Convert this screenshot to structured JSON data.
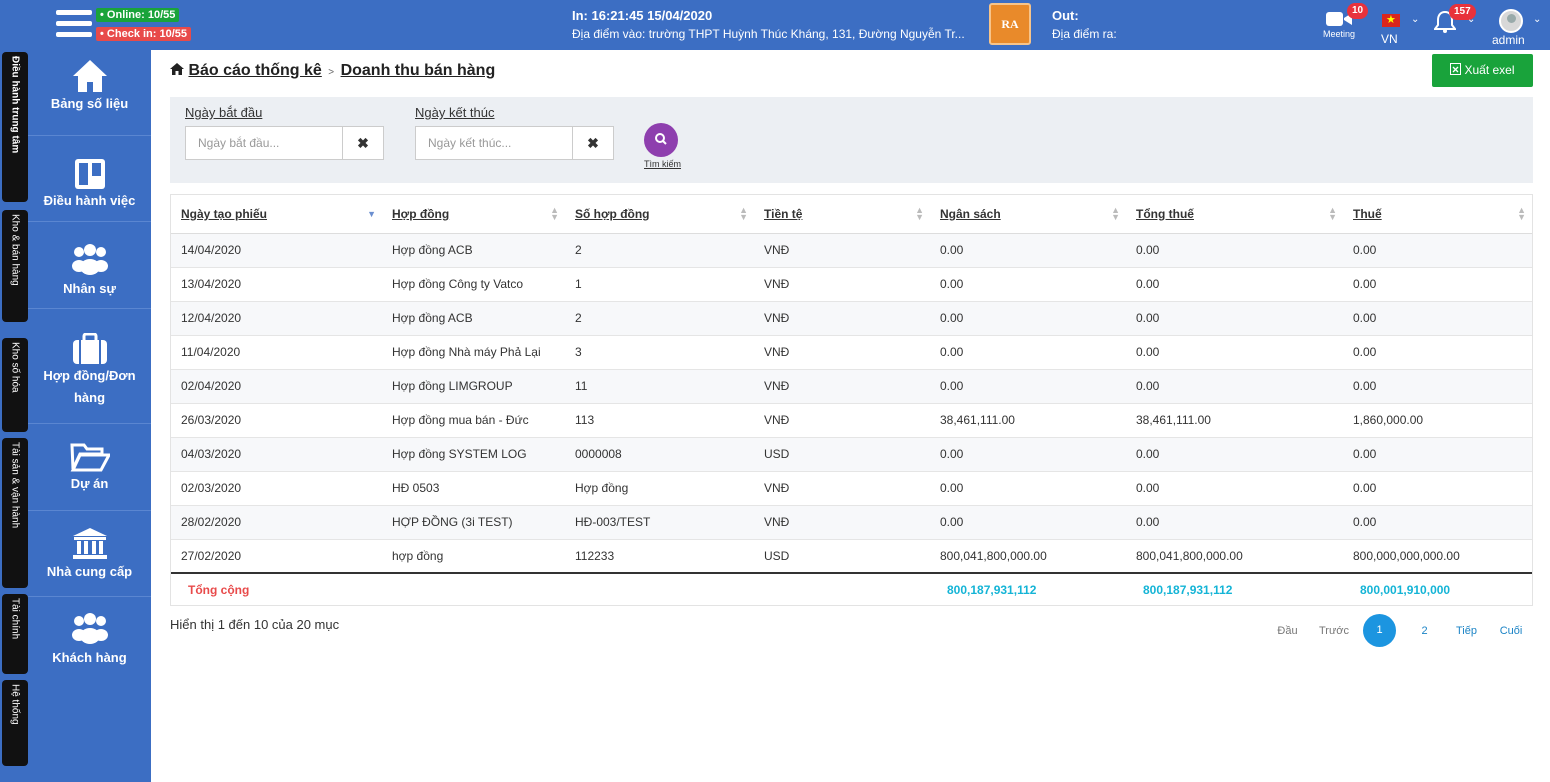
{
  "topbar": {
    "online": "Online: 10/55",
    "checkin": "Check in: 10/55",
    "in_time": "In: 16:21:45 15/04/2020",
    "in_location": "Địa điểm vào: trường THPT Huỳnh Thúc Kháng, 131, Đường Nguyễn Tr...",
    "logo_text": "RA",
    "out_time": "Out:",
    "out_location": "Địa điểm ra:",
    "meeting_label": "Meeting",
    "meeting_count": "10",
    "language": "VN",
    "notification_count": "157",
    "user": "admin"
  },
  "strip_tabs": [
    "Điều hành trung tâm",
    "Kho & bán hàng",
    "Kho số hóa",
    "Tài sản & vận hành",
    "Tài chính",
    "Hệ thống"
  ],
  "sidenav": [
    {
      "label": "Bảng số liệu",
      "icon": "home-icon"
    },
    {
      "label": "Điều hành việc",
      "icon": "board-icon"
    },
    {
      "label": "Nhân sự",
      "icon": "users-icon"
    },
    {
      "label": "Hợp đồng/Đơn hàng",
      "icon": "briefcase-icon"
    },
    {
      "label": "Dự án",
      "icon": "folder-open-icon"
    },
    {
      "label": "Nhà cung cấp",
      "icon": "bank-icon"
    },
    {
      "label": "Khách hàng",
      "icon": "users-icon"
    }
  ],
  "breadcrumb": {
    "parent": "Báo cáo thống kê",
    "separator": ">",
    "current": "Doanh thu bán hàng"
  },
  "export_label": "Xuất exel",
  "filter": {
    "start_label": "Ngày bắt đầu",
    "start_placeholder": "Ngày bắt đầu...",
    "end_label": "Ngày kết thúc",
    "end_placeholder": "Ngày kết thúc...",
    "search_label": "Tìm kiếm"
  },
  "table": {
    "columns": [
      "Ngày tạo phiếu",
      "Hợp đồng",
      "Số hợp đồng",
      "Tiền tệ",
      "Ngân sách",
      "Tổng thuế",
      "Thuế"
    ],
    "rows": [
      [
        "14/04/2020",
        "Hợp đồng ACB",
        "2",
        "VNĐ",
        "0.00",
        "0.00",
        "0.00"
      ],
      [
        "13/04/2020",
        "Hợp đồng Công ty Vatco",
        "1",
        "VNĐ",
        "0.00",
        "0.00",
        "0.00"
      ],
      [
        "12/04/2020",
        "Hợp đồng ACB",
        "2",
        "VNĐ",
        "0.00",
        "0.00",
        "0.00"
      ],
      [
        "11/04/2020",
        "Hợp đồng Nhà máy Phả Lại",
        "3",
        "VNĐ",
        "0.00",
        "0.00",
        "0.00"
      ],
      [
        "02/04/2020",
        "Hợp đồng LIMGROUP",
        "11",
        "VNĐ",
        "0.00",
        "0.00",
        "0.00"
      ],
      [
        "26/03/2020",
        "Hợp đồng mua bán - Đức",
        "113",
        "VNĐ",
        "38,461,111.00",
        "38,461,111.00",
        "1,860,000.00"
      ],
      [
        "04/03/2020",
        "Hợp đồng SYSTEM LOG",
        "0000008",
        "USD",
        "0.00",
        "0.00",
        "0.00"
      ],
      [
        "02/03/2020",
        "HĐ 0503",
        "Hợp đồng",
        "VNĐ",
        "0.00",
        "0.00",
        "0.00"
      ],
      [
        "28/02/2020",
        "HỢP ĐỒNG (3i TEST)",
        "HĐ-003/TEST",
        "VNĐ",
        "0.00",
        "0.00",
        "0.00"
      ],
      [
        "27/02/2020",
        "hợp đồng",
        "112233",
        "USD",
        "800,041,800,000.00",
        "800,041,800,000.00",
        "800,000,000,000.00"
      ]
    ],
    "total_label": "Tổng cộng",
    "totals": {
      "budget": "800,187,931,112",
      "total_tax": "800,187,931,112",
      "tax": "800,001,910,000"
    }
  },
  "info": "Hiển thị 1 đến 10 của 20 mục",
  "pagination": {
    "first": "Đầu",
    "prev": "Trước",
    "pages": [
      "1",
      "2"
    ],
    "next": "Tiếp",
    "last": "Cuối"
  },
  "colors": {
    "primary": "#3c6ec3",
    "export": "#19a33b",
    "search": "#8e3fae",
    "total_label": "#e84a4a",
    "total_value": "#14b4d6",
    "active_page": "#1c95e0"
  }
}
